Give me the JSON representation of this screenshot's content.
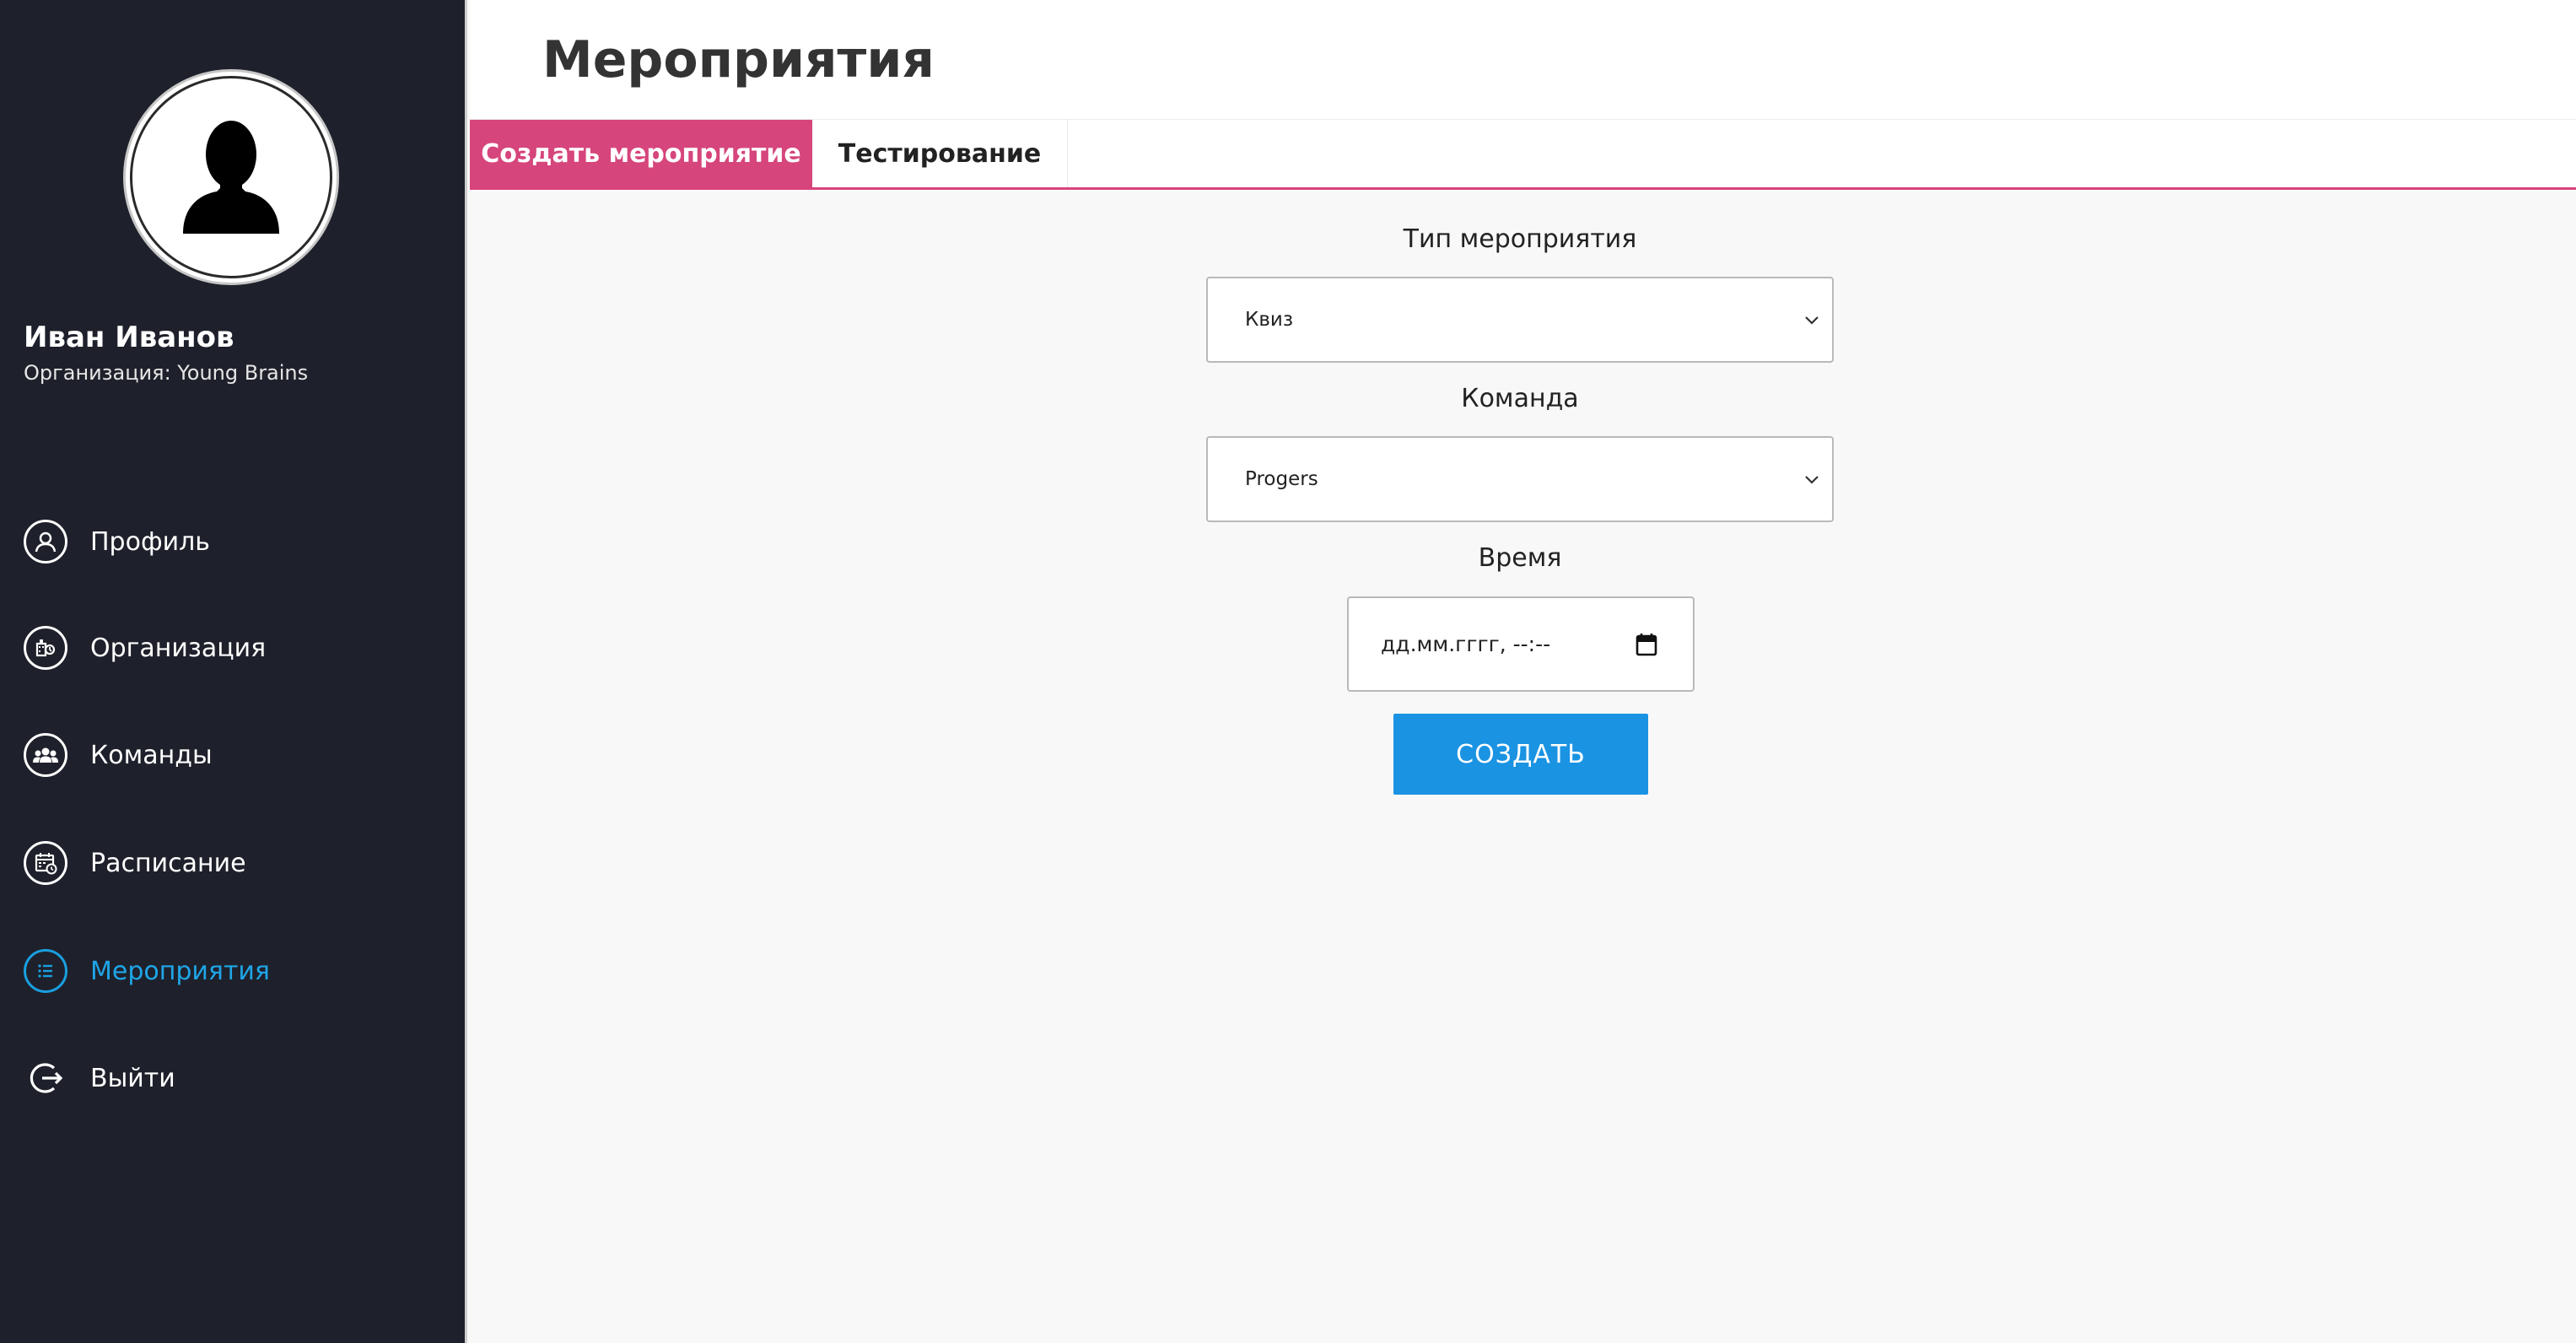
{
  "user": {
    "name": "Иван Иванов",
    "organization": "Организация: Young Brains"
  },
  "sidebar": {
    "items": [
      {
        "label": "Профиль",
        "icon": "profile-icon"
      },
      {
        "label": "Организация",
        "icon": "organization-icon"
      },
      {
        "label": "Команды",
        "icon": "teams-icon"
      },
      {
        "label": "Расписание",
        "icon": "schedule-icon"
      },
      {
        "label": "Мероприятия",
        "icon": "events-list-icon",
        "active": true
      },
      {
        "label": "Выйти",
        "icon": "logout-icon"
      }
    ]
  },
  "header": {
    "title": "Мероприятия"
  },
  "tabs": {
    "active": "Создать мероприятие",
    "inactive": "Тестирование"
  },
  "form": {
    "event_type_label": "Тип мероприятия",
    "event_type_value": "Квиз",
    "team_label": "Команда",
    "team_value": "Progers",
    "time_label": "Время",
    "time_placeholder": "дд.мм.гггг, --:--",
    "submit_label": "СОЗДАТЬ"
  },
  "colors": {
    "sidebar_bg": "#1e212b",
    "accent_pink": "#d6457c",
    "accent_blue": "#1a93e3",
    "active_nav": "#1fa6e8"
  }
}
